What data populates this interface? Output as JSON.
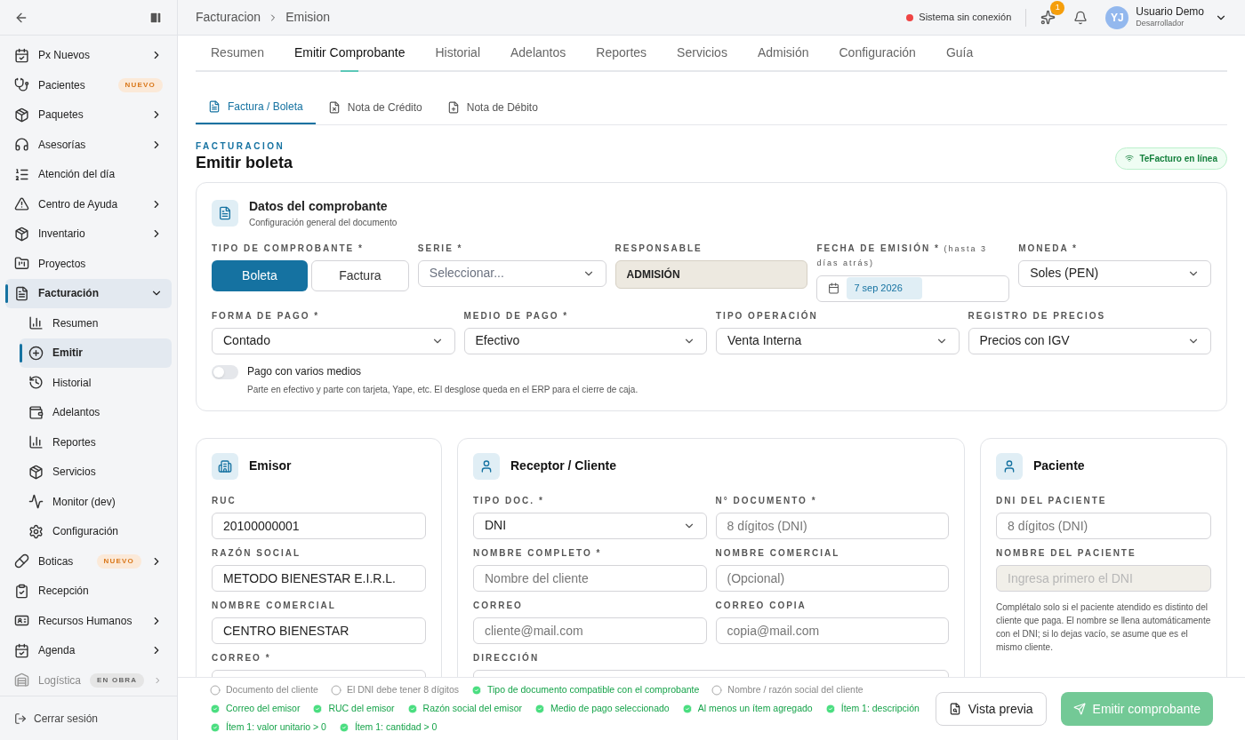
{
  "sidebar": {
    "items": [
      {
        "label": "Px Nuevos",
        "expandable": true,
        "selected": false,
        "disabled": false
      },
      {
        "label": "Pacientes",
        "badge": "NUEVO",
        "expandable": false,
        "selected": false,
        "disabled": false
      },
      {
        "label": "Paquetes",
        "expandable": true,
        "selected": false,
        "disabled": false
      },
      {
        "label": "Asesorías",
        "expandable": true,
        "selected": false,
        "disabled": false
      },
      {
        "label": "Atención del día",
        "expandable": false,
        "selected": false,
        "disabled": false
      },
      {
        "label": "Centro de Ayuda",
        "expandable": true,
        "selected": false,
        "disabled": false
      },
      {
        "label": "Inventario",
        "expandable": true,
        "selected": false,
        "disabled": false
      },
      {
        "label": "Proyectos",
        "expandable": false,
        "selected": false,
        "disabled": false
      },
      {
        "label": "Facturación",
        "expandable": true,
        "expanded": true,
        "selected": true,
        "disabled": false,
        "children": [
          {
            "label": "Resumen",
            "selected": false
          },
          {
            "label": "Emitir",
            "selected": true
          },
          {
            "label": "Historial",
            "selected": false
          },
          {
            "label": "Adelantos",
            "selected": false
          },
          {
            "label": "Reportes",
            "selected": false
          },
          {
            "label": "Servicios",
            "selected": false
          },
          {
            "label": "Monitor (dev)",
            "selected": false
          },
          {
            "label": "Configuración",
            "selected": false
          }
        ]
      },
      {
        "label": "Boticas",
        "badge": "NUEVO",
        "expandable": true,
        "selected": false,
        "disabled": false
      },
      {
        "label": "Recepción",
        "expandable": false,
        "selected": false,
        "disabled": false
      },
      {
        "label": "Recursos Humanos",
        "expandable": true,
        "selected": false,
        "disabled": false
      },
      {
        "label": "Agenda",
        "expandable": true,
        "selected": false,
        "disabled": false
      },
      {
        "label": "Logística",
        "badge": "EN OBRA",
        "expandable": true,
        "selected": false,
        "disabled": true
      }
    ],
    "logout": "Cerrar sesión"
  },
  "topbar": {
    "breadcrumbs": [
      "Facturacion",
      "Emision"
    ],
    "status": {
      "text": "Sistema sin conexión",
      "online": false
    },
    "notifications": "1",
    "user": {
      "initials": "YJ",
      "name": "Usuario Demo",
      "role": "Desarrollador"
    }
  },
  "tabs": [
    {
      "label": "Resumen",
      "selected": false
    },
    {
      "label": "Emitir Comprobante",
      "selected": true
    },
    {
      "label": "Historial",
      "selected": false
    },
    {
      "label": "Adelantos",
      "selected": false
    },
    {
      "label": "Reportes",
      "selected": false
    },
    {
      "label": "Servicios",
      "selected": false
    },
    {
      "label": "Admisión",
      "selected": false
    },
    {
      "label": "Configuración",
      "selected": false
    },
    {
      "label": "Guía",
      "selected": false
    }
  ],
  "subtabs": [
    {
      "label": "Factura / Boleta",
      "selected": true
    },
    {
      "label": "Nota de Crédito",
      "selected": false
    },
    {
      "label": "Nota de Débito",
      "selected": false
    }
  ],
  "heading": {
    "eyebrow": "FACTURACION",
    "title": "Emitir boleta",
    "service_badge": "TeFacturo en línea"
  },
  "comprobante": {
    "title": "Datos del comprobante",
    "subtitle": "Configuración general del documento",
    "tipo": {
      "label": "TIPO DE COMPROBANTE *",
      "options": [
        {
          "label": "Boleta",
          "selected": true
        },
        {
          "label": "Factura",
          "selected": false
        }
      ]
    },
    "serie": {
      "label": "SERIE *",
      "placeholder": "Seleccionar..."
    },
    "responsable": {
      "label": "RESPONSABLE",
      "value": "ADMISIÓN"
    },
    "fecha": {
      "label": "FECHA DE EMISIÓN *",
      "hint": "(hasta 3 días atrás)",
      "value": "7 sep 2026"
    },
    "moneda": {
      "label": "MONEDA *",
      "value": "Soles (PEN)"
    },
    "selects": [
      {
        "label": "FORMA DE PAGO *",
        "value": "Contado"
      },
      {
        "label": "MEDIO DE PAGO *",
        "value": "Efectivo"
      },
      {
        "label": "TIPO OPERACIÓN",
        "value": "Venta Interna"
      },
      {
        "label": "REGISTRO DE PRECIOS",
        "value": "Precios con IGV"
      }
    ],
    "toggle": {
      "label": "Pago con varios medios",
      "description": "Parte en efectivo y parte con tarjeta, Yape, etc. El desglose queda en el ERP para el cierre de caja.",
      "on": false
    }
  },
  "emisor": {
    "title": "Emisor",
    "fields": [
      {
        "label": "RUC",
        "value": "20100000001"
      },
      {
        "label": "RAZÓN SOCIAL",
        "value": "METODO BIENESTAR E.I.R.L."
      },
      {
        "label": "NOMBRE COMERCIAL",
        "value": "CENTRO BIENESTAR"
      },
      {
        "label": "CORREO *"
      }
    ]
  },
  "receptor": {
    "title": "Receptor / Cliente",
    "fields": [
      {
        "kind": "select",
        "label": "TIPO DOC. *",
        "value": "DNI"
      },
      {
        "kind": "input",
        "label": "N° DOCUMENTO *",
        "placeholder": "8 dígitos (DNI)"
      },
      {
        "kind": "input",
        "label": "NOMBRE COMPLETO *",
        "placeholder": "Nombre del cliente"
      },
      {
        "kind": "input",
        "label": "NOMBRE COMERCIAL",
        "placeholder": "(Opcional)"
      },
      {
        "kind": "input",
        "label": "CORREO",
        "placeholder": "cliente@mail.com"
      },
      {
        "kind": "input",
        "label": "CORREO COPIA",
        "placeholder": "copia@mail.com"
      },
      {
        "kind": "wide",
        "label": "DIRECCIÓN"
      }
    ]
  },
  "paciente": {
    "title": "Paciente",
    "fields": [
      {
        "label": "DNI DEL PACIENTE",
        "placeholder": "8 dígitos (DNI)",
        "disabled": false
      },
      {
        "label": "NOMBRE DEL PACIENTE",
        "placeholder": "Ingresa primero el DNI",
        "disabled": true
      }
    ],
    "note": "Complétalo solo si el paciente atendido es distinto del cliente que paga. El nombre se llena automáticamente con el DNI; si lo dejas vacío, se asume que es el mismo cliente."
  },
  "footer": {
    "checks": [
      {
        "label": "Documento del cliente",
        "checked": false
      },
      {
        "label": "El DNI debe tener 8 dígitos",
        "checked": false
      },
      {
        "label": "Tipo de documento compatible con el comprobante",
        "checked": true
      },
      {
        "label": "Nombre / razón social del cliente",
        "checked": false
      },
      {
        "label": "Correo del emisor",
        "checked": true
      },
      {
        "label": "RUC del emisor",
        "checked": true
      },
      {
        "label": "Razón social del emisor",
        "checked": true
      },
      {
        "label": "Medio de pago seleccionado",
        "checked": true
      },
      {
        "label": "Al menos un ítem agregado",
        "checked": true
      },
      {
        "label": "Ítem 1: descripción",
        "checked": true
      },
      {
        "label": "Ítem 1: valor unitario > 0",
        "checked": true
      },
      {
        "label": "Ítem 1: cantidad > 0",
        "checked": true
      }
    ],
    "preview_button": "Vista previa",
    "emit_button": "Emitir comprobante"
  }
}
